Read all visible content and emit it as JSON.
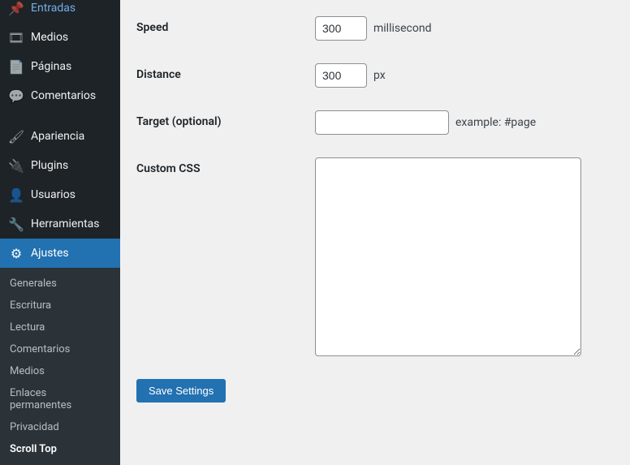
{
  "sidebar": {
    "items": [
      {
        "label": "Entradas",
        "icon": "📌"
      },
      {
        "label": "Medios",
        "icon": "🎞"
      },
      {
        "label": "Páginas",
        "icon": "📄"
      },
      {
        "label": "Comentarios",
        "icon": "💬"
      },
      {
        "label": "Apariencia",
        "icon": "🖌"
      },
      {
        "label": "Plugins",
        "icon": "🔌"
      },
      {
        "label": "Usuarios",
        "icon": "👤"
      },
      {
        "label": "Herramientas",
        "icon": "🔧"
      },
      {
        "label": "Ajustes",
        "icon": "⚙"
      }
    ],
    "submenu": [
      {
        "label": "Generales"
      },
      {
        "label": "Escritura"
      },
      {
        "label": "Lectura"
      },
      {
        "label": "Comentarios"
      },
      {
        "label": "Medios"
      },
      {
        "label": "Enlaces permanentes"
      },
      {
        "label": "Privacidad"
      },
      {
        "label": "Scroll Top"
      }
    ]
  },
  "form": {
    "speed": {
      "label": "Speed",
      "value": "300",
      "unit": "millisecond"
    },
    "distance": {
      "label": "Distance",
      "value": "300",
      "unit": "px"
    },
    "target": {
      "label": "Target (optional)",
      "value": "",
      "example": "example: #page"
    },
    "custom_css": {
      "label": "Custom CSS",
      "value": ""
    },
    "save_label": "Save Settings"
  }
}
